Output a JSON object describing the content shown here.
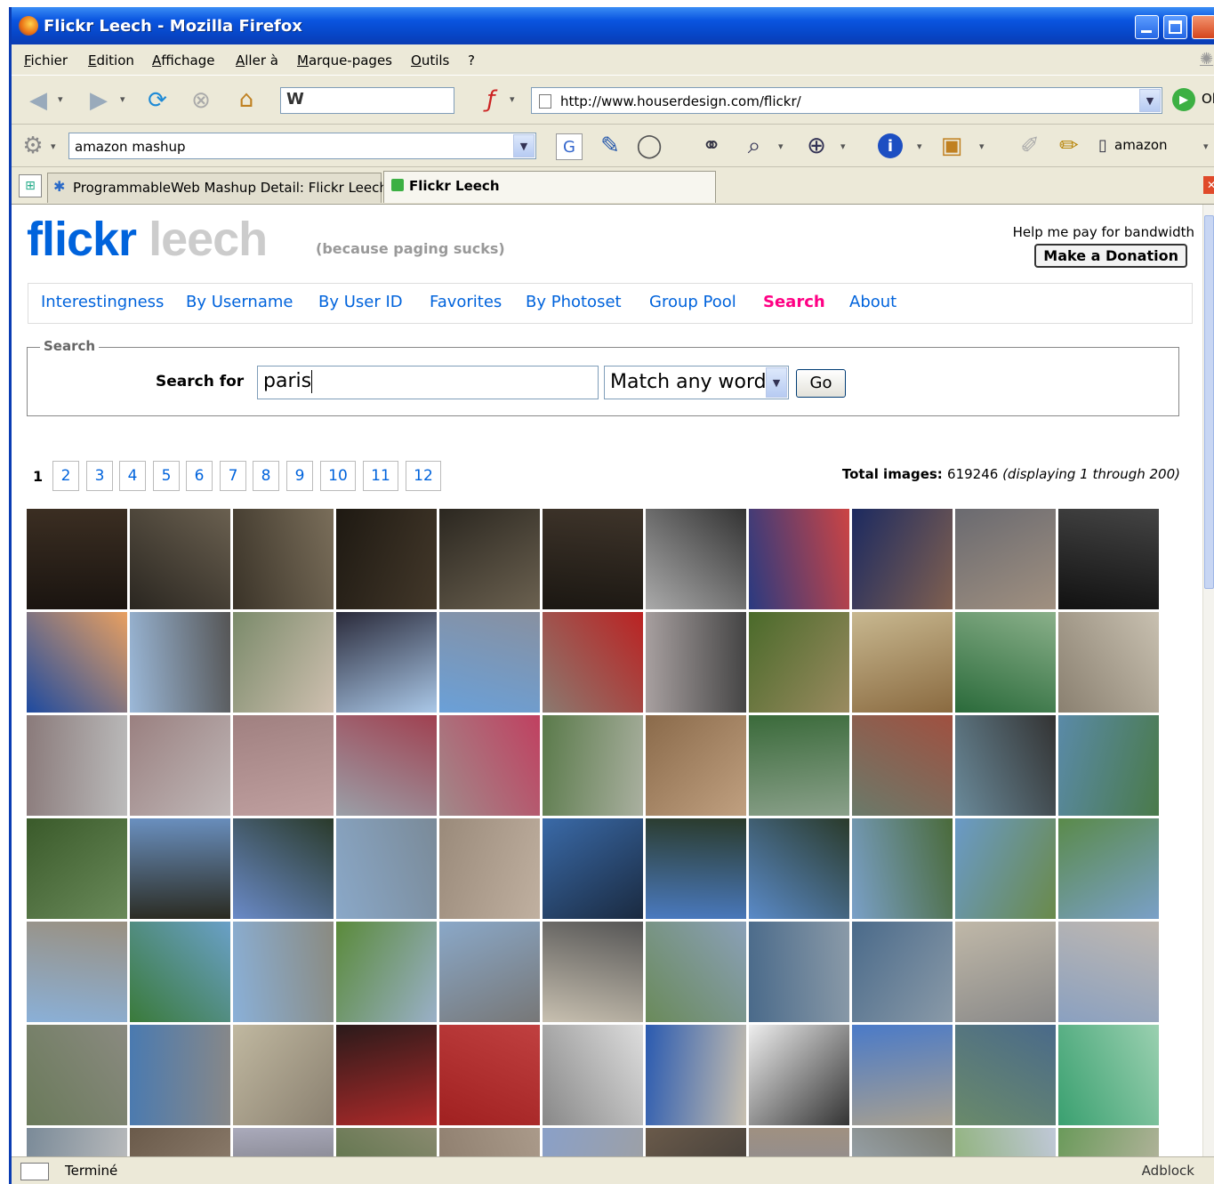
{
  "window": {
    "title": "Flickr Leech - Mozilla Firefox"
  },
  "menu": [
    "Fichier",
    "Edition",
    "Affichage",
    "Aller à",
    "Marque-pages",
    "Outils",
    "?"
  ],
  "toolbar": {
    "url": "http://www.houserdesign.com/flickr/",
    "go_partial": "Ol"
  },
  "searchbar": {
    "query": "amazon mashup",
    "amazon_label": "amazon"
  },
  "tabs": [
    {
      "label": "ProgrammableWeb Mashup Detail: Flickr Leech",
      "active": false
    },
    {
      "label": "Flickr Leech",
      "active": true
    }
  ],
  "page": {
    "logo_flickr": "flickr",
    "logo_leech": "leech",
    "tagline": "(because paging sucks)",
    "help_text": "Help me pay for bandwidth",
    "donate_label": "Make a Donation",
    "nav": [
      "Interestingness",
      "By Username",
      "By User ID",
      "Favorites",
      "By Photoset",
      "Group Pool",
      "Search",
      "About"
    ],
    "nav_active": "Search",
    "search": {
      "legend": "Search",
      "label": "Search for",
      "value": "paris",
      "mode": "Match any word",
      "go_label": "Go"
    },
    "pager": {
      "current": "1",
      "pages": [
        "2",
        "3",
        "4",
        "5",
        "6",
        "7",
        "8",
        "9",
        "10",
        "11",
        "12"
      ]
    },
    "total": {
      "label": "Total images",
      "count": "619246",
      "range": "(displaying 1 through 200)"
    }
  },
  "status": {
    "text": "Terminé",
    "adblock": "Adblock"
  },
  "colors": {
    "flickr_blue": "#0063dc",
    "flickr_pink": "#ff0084",
    "xp_title": "#0a55e0"
  },
  "photo_grid": {
    "columns": 11,
    "visible_rows": 7
  }
}
